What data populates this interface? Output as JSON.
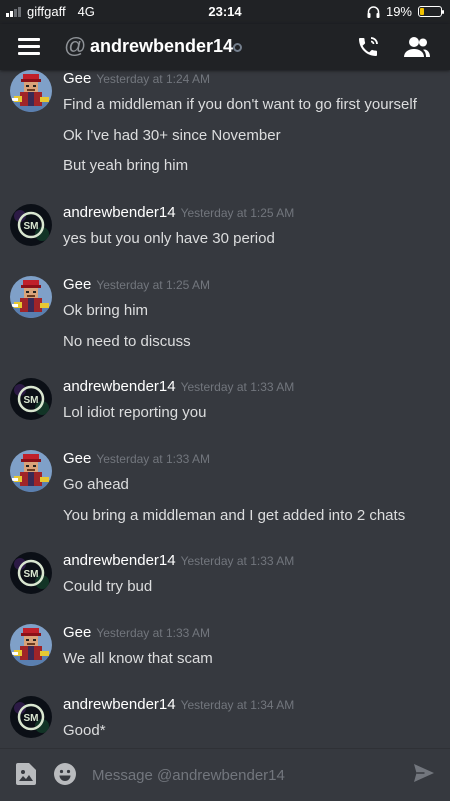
{
  "status_bar": {
    "carrier": "giffgaff",
    "network": "4G",
    "time": "23:14",
    "battery_percent": "19%",
    "battery_level": 0.19
  },
  "header": {
    "title": "andrewbender14",
    "at_symbol": "@"
  },
  "messages": [
    {
      "author": "Gee",
      "avatar": "gee-avatar",
      "timestamp": "Yesterday at 1:24 AM",
      "lines": [
        "Find a middleman if you don't want to go first yourself",
        "Ok I've had 30+ since November",
        "But yeah bring him"
      ]
    },
    {
      "author": "andrewbender14",
      "avatar": "andrew-avatar",
      "timestamp": "Yesterday at 1:25 AM",
      "lines": [
        "yes but you only have 30 period"
      ]
    },
    {
      "author": "Gee",
      "avatar": "gee-avatar",
      "timestamp": "Yesterday at 1:25 AM",
      "lines": [
        "Ok bring him",
        "No need to discuss"
      ]
    },
    {
      "author": "andrewbender14",
      "avatar": "andrew-avatar",
      "timestamp": "Yesterday at 1:33 AM",
      "lines": [
        "Lol idiot reporting you"
      ]
    },
    {
      "author": "Gee",
      "avatar": "gee-avatar",
      "timestamp": "Yesterday at 1:33 AM",
      "lines": [
        "Go ahead",
        "You bring a middleman and I get added into 2 chats"
      ]
    },
    {
      "author": "andrewbender14",
      "avatar": "andrew-avatar",
      "timestamp": "Yesterday at 1:33 AM",
      "lines": [
        "Could try bud"
      ]
    },
    {
      "author": "Gee",
      "avatar": "gee-avatar",
      "timestamp": "Yesterday at 1:33 AM",
      "lines": [
        "We all know that scam"
      ]
    },
    {
      "author": "andrewbender14",
      "avatar": "andrew-avatar",
      "timestamp": "Yesterday at 1:34 AM",
      "lines": [
        "Good*"
      ]
    }
  ],
  "composer": {
    "placeholder": "Message @andrewbender14"
  },
  "colors": {
    "background": "#36393f",
    "header": "#202225",
    "timestamp": "#72767d",
    "battery": "#f2c200"
  }
}
